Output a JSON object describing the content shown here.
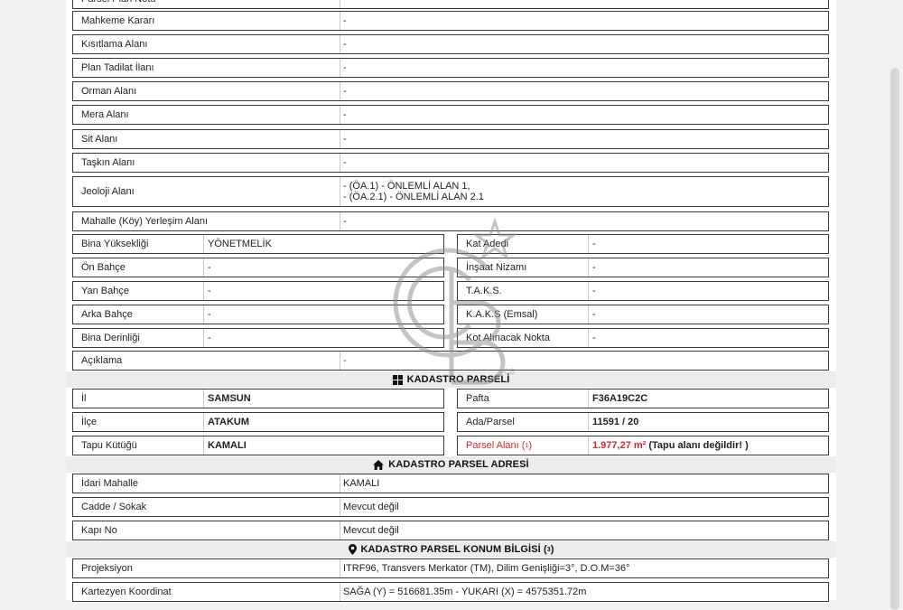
{
  "rows_top": [
    {
      "label": "Parsel Plan Notu",
      "value": ""
    },
    {
      "label": "Mahkeme Kararı",
      "value": "-"
    },
    {
      "label": "Kısıtlama Alanı",
      "value": "-"
    },
    {
      "label": "Plan Tadilat İlanı",
      "value": "-"
    },
    {
      "label": "Orman Alanı",
      "value": "-"
    },
    {
      "label": "Mera Alanı",
      "value": "-"
    },
    {
      "label": "Sit Alanı",
      "value": "-"
    },
    {
      "label": "Taşkın Alanı",
      "value": "-"
    }
  ],
  "jeoloji": {
    "label": "Jeoloji Alanı",
    "line1": "- (ÖA.1) - ÖNLEMLİ ALAN 1,",
    "line2": "- (ÖA.2.1) - ÖNLEMLİ ALAN 2.1"
  },
  "mahalle_yerlesim": {
    "label": "Mahalle (Köy) Yerleşim Alanı",
    "value": "-"
  },
  "imar_pairs": [
    {
      "l_label": "Bina Yüksekliği",
      "l_value": "YÖNETMELİK",
      "r_label": "Kat Adedi",
      "r_value": "-"
    },
    {
      "l_label": "Ön Bahçe",
      "l_value": "-",
      "r_label": "İnşaat Nizamı",
      "r_value": "-"
    },
    {
      "l_label": "Yan Bahçe",
      "l_value": "-",
      "r_label": "T.A.K.S.",
      "r_value": "-"
    },
    {
      "l_label": "Arka Bahçe",
      "l_value": "-",
      "r_label": "K.A.K.S (Emsal)",
      "r_value": "-"
    },
    {
      "l_label": "Bina Derinliği",
      "l_value": "-",
      "r_label": "Kot Alınacak Nokta",
      "r_value": "-"
    }
  ],
  "aciklama": {
    "label": "Açıklama",
    "value": "-"
  },
  "kadastro_parseli": {
    "title": "KADASTRO PARSELİ",
    "pairs": [
      {
        "l_label": "İl",
        "l_value": "SAMSUN",
        "r_label": "Pafta",
        "r_value": "F36A19C2C"
      },
      {
        "l_label": "İlçe",
        "l_value": "ATAKUM",
        "r_label": "Ada/Parsel",
        "r_value": "11591 / 20"
      },
      {
        "l_label": "Tapu Kütüğü",
        "l_value": "KAMALI",
        "r_label": "Parsel Alanı (",
        "r_label_sup": "1",
        "r_label_end": ")",
        "r_value": "1.977,27 m²",
        "r_value_note": "(Tapu alanı değildir! )"
      }
    ]
  },
  "kadastro_adres": {
    "title": "KADASTRO PARSEL ADRESİ",
    "rows": [
      {
        "label": "İdari Mahalle",
        "value": "KAMALI"
      },
      {
        "label": "Cadde / Sokak",
        "value": "Mevcut değil"
      },
      {
        "label": "Kapı No",
        "value": "Mevcut değil"
      }
    ]
  },
  "konum": {
    "title": "KADASTRO PARSEL KONUM BİLGİSİ (",
    "title_sup": "3",
    "title_end": ")",
    "rows": [
      {
        "label": "Projeksiyon",
        "value": "ITRF96, Transvers Merkator (TM), Dilim Genişliği=3°, D.O.M=36°"
      },
      {
        "label": "Kartezyen Koordinat",
        "value": "SAĞA (Y) = 516681.35m - YUKARI (X) = 4575351.72m"
      }
    ]
  },
  "colors": {
    "red": "#d42a2a",
    "blue": "#1a55c4",
    "section_bg": "#ececec"
  },
  "watermark_text": "CB"
}
